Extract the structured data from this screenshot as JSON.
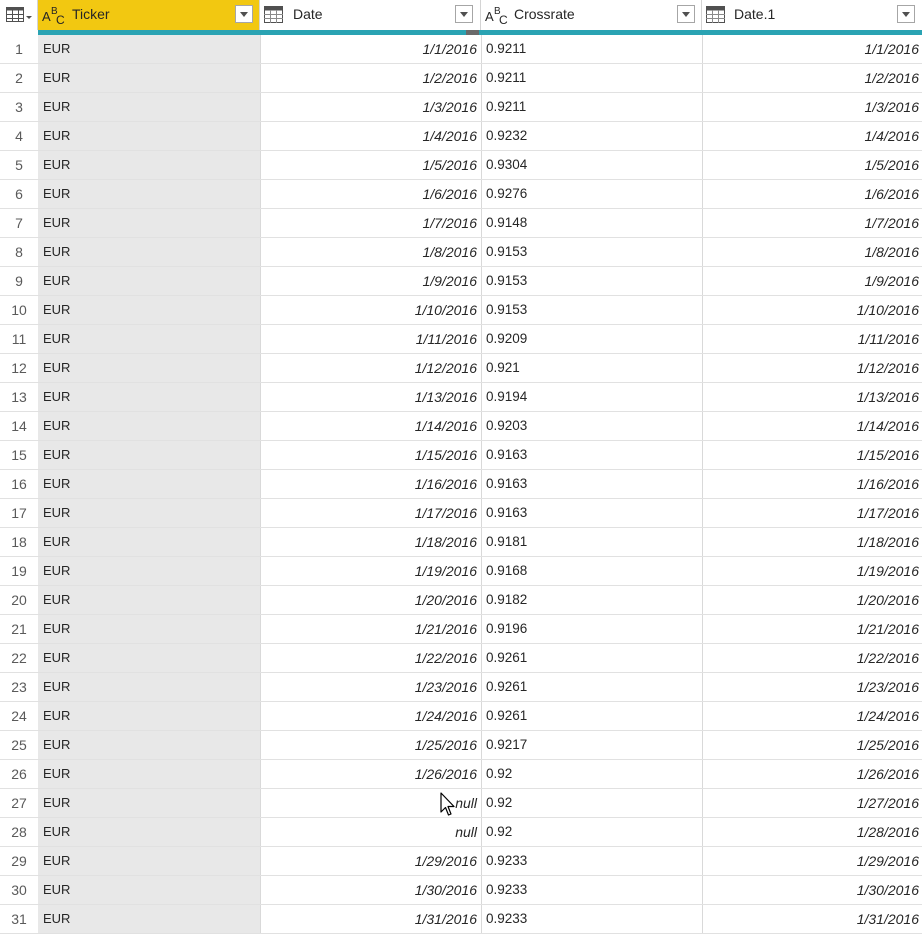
{
  "columns": {
    "ticker": {
      "name": "Ticker",
      "type_icon": "text-type-icon"
    },
    "date": {
      "name": "Date",
      "type_icon": "date-type-icon"
    },
    "crossrate": {
      "name": "Crossrate",
      "type_icon": "text-type-icon"
    },
    "date1": {
      "name": "Date.1",
      "type_icon": "date-type-icon"
    }
  },
  "colors": {
    "selected_header": "#f2c811",
    "quality_bar": "#2aa3b3",
    "selected_column_bg": "#e8e8e8"
  },
  "rows": [
    {
      "idx": "1",
      "ticker": "EUR",
      "date": "1/1/2016",
      "crossrate": "0.9211",
      "date1": "1/1/2016"
    },
    {
      "idx": "2",
      "ticker": "EUR",
      "date": "1/2/2016",
      "crossrate": "0.9211",
      "date1": "1/2/2016"
    },
    {
      "idx": "3",
      "ticker": "EUR",
      "date": "1/3/2016",
      "crossrate": "0.9211",
      "date1": "1/3/2016"
    },
    {
      "idx": "4",
      "ticker": "EUR",
      "date": "1/4/2016",
      "crossrate": "0.9232",
      "date1": "1/4/2016"
    },
    {
      "idx": "5",
      "ticker": "EUR",
      "date": "1/5/2016",
      "crossrate": "0.9304",
      "date1": "1/5/2016"
    },
    {
      "idx": "6",
      "ticker": "EUR",
      "date": "1/6/2016",
      "crossrate": "0.9276",
      "date1": "1/6/2016"
    },
    {
      "idx": "7",
      "ticker": "EUR",
      "date": "1/7/2016",
      "crossrate": "0.9148",
      "date1": "1/7/2016"
    },
    {
      "idx": "8",
      "ticker": "EUR",
      "date": "1/8/2016",
      "crossrate": "0.9153",
      "date1": "1/8/2016"
    },
    {
      "idx": "9",
      "ticker": "EUR",
      "date": "1/9/2016",
      "crossrate": "0.9153",
      "date1": "1/9/2016"
    },
    {
      "idx": "10",
      "ticker": "EUR",
      "date": "1/10/2016",
      "crossrate": "0.9153",
      "date1": "1/10/2016"
    },
    {
      "idx": "11",
      "ticker": "EUR",
      "date": "1/11/2016",
      "crossrate": "0.9209",
      "date1": "1/11/2016"
    },
    {
      "idx": "12",
      "ticker": "EUR",
      "date": "1/12/2016",
      "crossrate": "0.921",
      "date1": "1/12/2016"
    },
    {
      "idx": "13",
      "ticker": "EUR",
      "date": "1/13/2016",
      "crossrate": "0.9194",
      "date1": "1/13/2016"
    },
    {
      "idx": "14",
      "ticker": "EUR",
      "date": "1/14/2016",
      "crossrate": "0.9203",
      "date1": "1/14/2016"
    },
    {
      "idx": "15",
      "ticker": "EUR",
      "date": "1/15/2016",
      "crossrate": "0.9163",
      "date1": "1/15/2016"
    },
    {
      "idx": "16",
      "ticker": "EUR",
      "date": "1/16/2016",
      "crossrate": "0.9163",
      "date1": "1/16/2016"
    },
    {
      "idx": "17",
      "ticker": "EUR",
      "date": "1/17/2016",
      "crossrate": "0.9163",
      "date1": "1/17/2016"
    },
    {
      "idx": "18",
      "ticker": "EUR",
      "date": "1/18/2016",
      "crossrate": "0.9181",
      "date1": "1/18/2016"
    },
    {
      "idx": "19",
      "ticker": "EUR",
      "date": "1/19/2016",
      "crossrate": "0.9168",
      "date1": "1/19/2016"
    },
    {
      "idx": "20",
      "ticker": "EUR",
      "date": "1/20/2016",
      "crossrate": "0.9182",
      "date1": "1/20/2016"
    },
    {
      "idx": "21",
      "ticker": "EUR",
      "date": "1/21/2016",
      "crossrate": "0.9196",
      "date1": "1/21/2016"
    },
    {
      "idx": "22",
      "ticker": "EUR",
      "date": "1/22/2016",
      "crossrate": "0.9261",
      "date1": "1/22/2016"
    },
    {
      "idx": "23",
      "ticker": "EUR",
      "date": "1/23/2016",
      "crossrate": "0.9261",
      "date1": "1/23/2016"
    },
    {
      "idx": "24",
      "ticker": "EUR",
      "date": "1/24/2016",
      "crossrate": "0.9261",
      "date1": "1/24/2016"
    },
    {
      "idx": "25",
      "ticker": "EUR",
      "date": "1/25/2016",
      "crossrate": "0.9217",
      "date1": "1/25/2016"
    },
    {
      "idx": "26",
      "ticker": "EUR",
      "date": "1/26/2016",
      "crossrate": "0.92",
      "date1": "1/26/2016"
    },
    {
      "idx": "27",
      "ticker": "EUR",
      "date": "null",
      "crossrate": "0.92",
      "date1": "1/27/2016"
    },
    {
      "idx": "28",
      "ticker": "EUR",
      "date": "null",
      "crossrate": "0.92",
      "date1": "1/28/2016"
    },
    {
      "idx": "29",
      "ticker": "EUR",
      "date": "1/29/2016",
      "crossrate": "0.9233",
      "date1": "1/29/2016"
    },
    {
      "idx": "30",
      "ticker": "EUR",
      "date": "1/30/2016",
      "crossrate": "0.9233",
      "date1": "1/30/2016"
    },
    {
      "idx": "31",
      "ticker": "EUR",
      "date": "1/31/2016",
      "crossrate": "0.9233",
      "date1": "1/31/2016"
    }
  ]
}
